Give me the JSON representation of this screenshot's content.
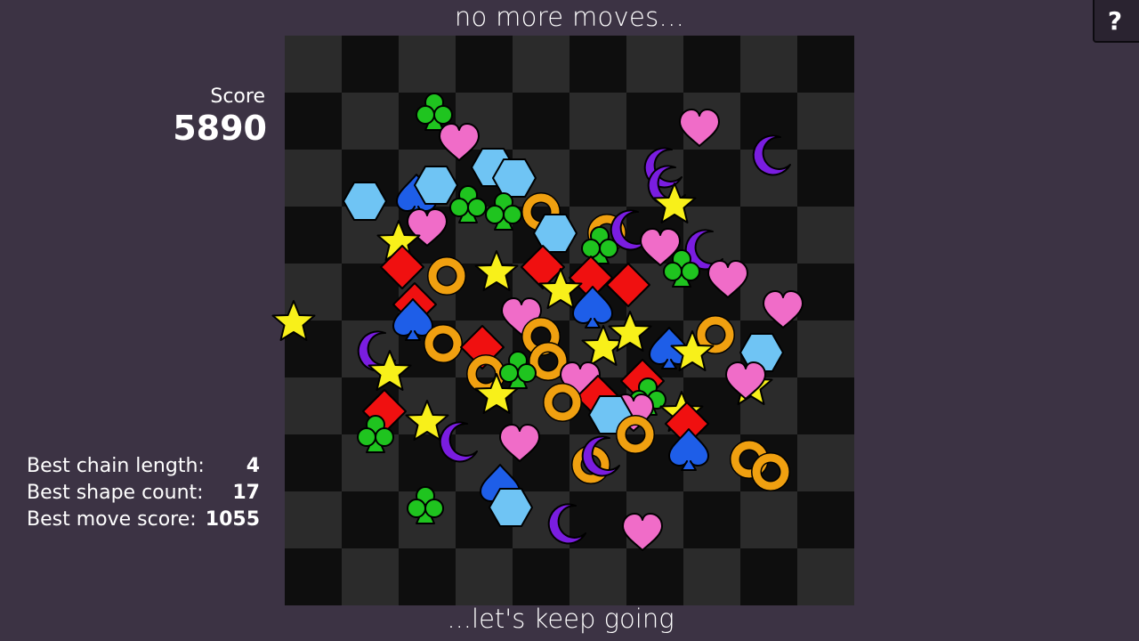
{
  "header": {
    "message": "no more moves..."
  },
  "footer": {
    "message": "...let's keep going"
  },
  "help": {
    "label": "?"
  },
  "score": {
    "label": "Score",
    "value": "5890"
  },
  "stats": [
    {
      "label": "Best chain length:",
      "value": "4"
    },
    {
      "label": "Best shape count:",
      "value": "17"
    },
    {
      "label": "Best move score:",
      "value": "1055"
    }
  ],
  "board": {
    "rows": 10,
    "cols": 10,
    "colors": {
      "light": "#2b2b2b",
      "dark": "#0e0e0e"
    }
  },
  "shape_colors": {
    "club": "#1fc41f",
    "heart": "#f06cc8",
    "moon": "#7a1de0",
    "hexagon": "#6fc4f4",
    "spade": "#1e5ee8",
    "star": "#f8f01a",
    "diamond": "#f01010",
    "ring": "#f0a010"
  }
}
